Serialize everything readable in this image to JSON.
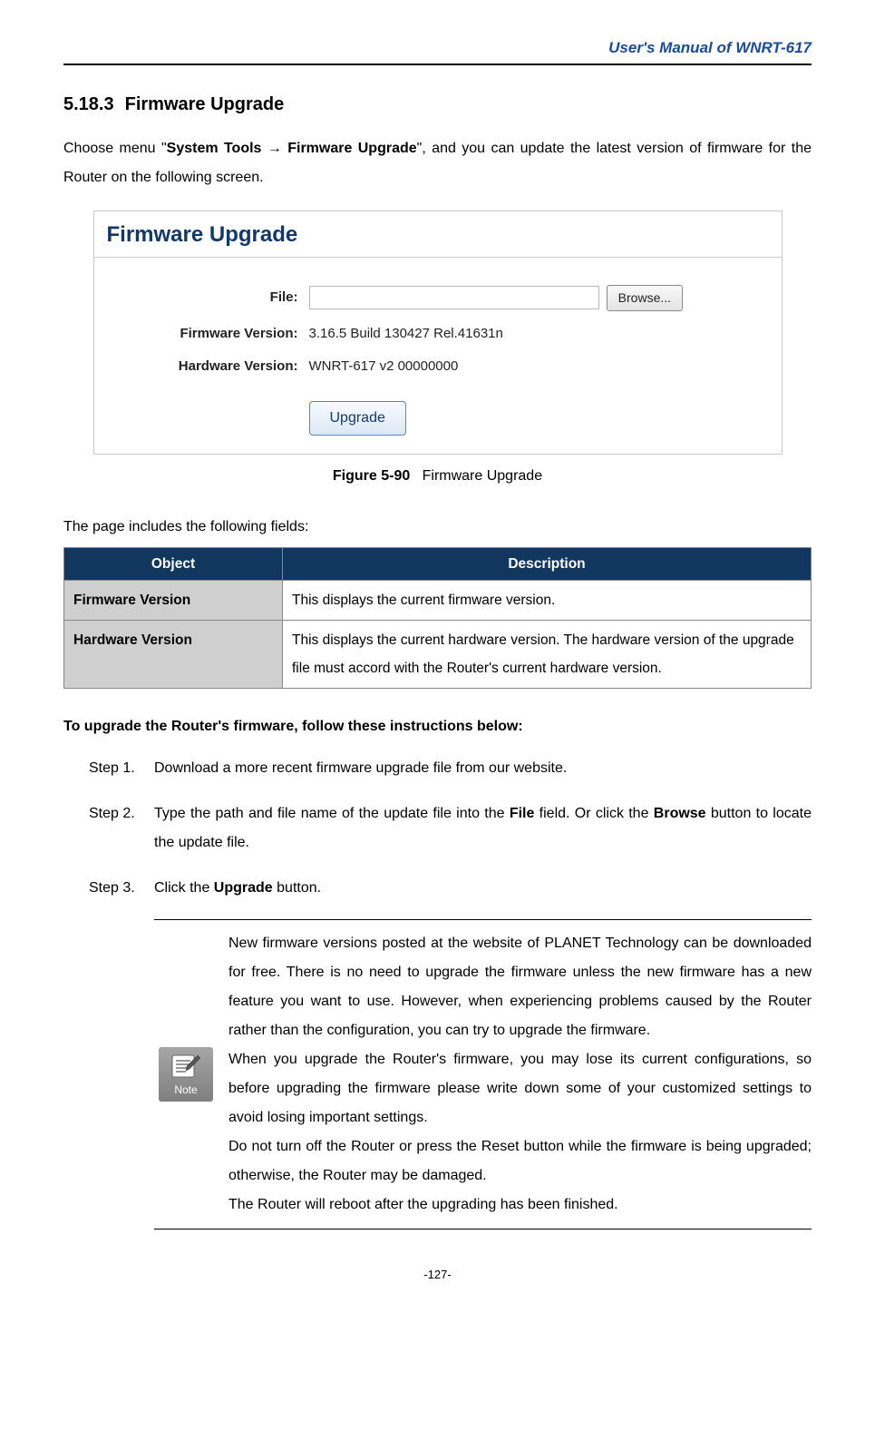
{
  "header": {
    "title": "User's  Manual  of  WNRT-617"
  },
  "section": {
    "number": "5.18.3",
    "title": "Firmware Upgrade"
  },
  "intro": {
    "prefix": "Choose  menu  \"",
    "bold1": "System  Tools  ",
    "arrow": "→",
    "bold2": "  Firmware  Upgrade",
    "suffix": "\",  and  you  can  update  the  latest  version  of firmware for the Router on the following screen."
  },
  "screenshot": {
    "title": "Firmware Upgrade",
    "labels": {
      "file": "File:",
      "fw": "Firmware Version:",
      "hw": "Hardware Version:"
    },
    "values": {
      "fw": "3.16.5 Build 130427 Rel.41631n",
      "hw": "WNRT-617 v2 00000000"
    },
    "buttons": {
      "browse": "Browse...",
      "upgrade": "Upgrade"
    }
  },
  "figure": {
    "label": "Figure 5-90",
    "caption": "Firmware Upgrade"
  },
  "table_intro": "The page includes the following fields:",
  "table": {
    "headers": {
      "object": "Object",
      "description": "Description"
    },
    "rows": [
      {
        "object": "Firmware Version",
        "description": "This displays the current firmware version."
      },
      {
        "object": "Hardware Version",
        "description": "This displays the current hardware version. The hardware version of the upgrade file must accord with the Router's current hardware version."
      }
    ]
  },
  "instructions_title": "To upgrade the Router's firmware, follow these instructions below:",
  "steps": [
    {
      "label": "Step 1.",
      "parts": [
        {
          "t": "Download a more recent firmware upgrade file from our website."
        }
      ]
    },
    {
      "label": "Step 2.",
      "parts": [
        {
          "t": "Type the path and file name of the update file into the "
        },
        {
          "b": "File"
        },
        {
          "t": " field. Or click the "
        },
        {
          "b": "Browse"
        },
        {
          "t": " button to locate the update file."
        }
      ]
    },
    {
      "label": "Step 3.",
      "parts": [
        {
          "t": "Click the "
        },
        {
          "b": "Upgrade"
        },
        {
          "t": " button."
        }
      ]
    }
  ],
  "note": {
    "icon_label": "Note",
    "paragraphs": [
      "New  firmware  versions  posted  at  the  website  of  PLANET  Technology  can  be downloaded for free. There is no need to upgrade the firmware unless the new firmware has a new feature you want to use. However, when experiencing problems caused by the Router rather than the configuration, you can try to upgrade the firmware.",
      "When you upgrade the Router's firmware, you may lose its current configurations, so before upgrading the firmware please write down some of your customized settings to avoid losing important settings.",
      "Do  not  turn  off  the  Router  or  press  the  Reset  button  while  the  firmware  is  being upgraded; otherwise, the Router may be damaged.",
      "The Router will reboot after the upgrading has been finished."
    ]
  },
  "page_number": "-127-"
}
